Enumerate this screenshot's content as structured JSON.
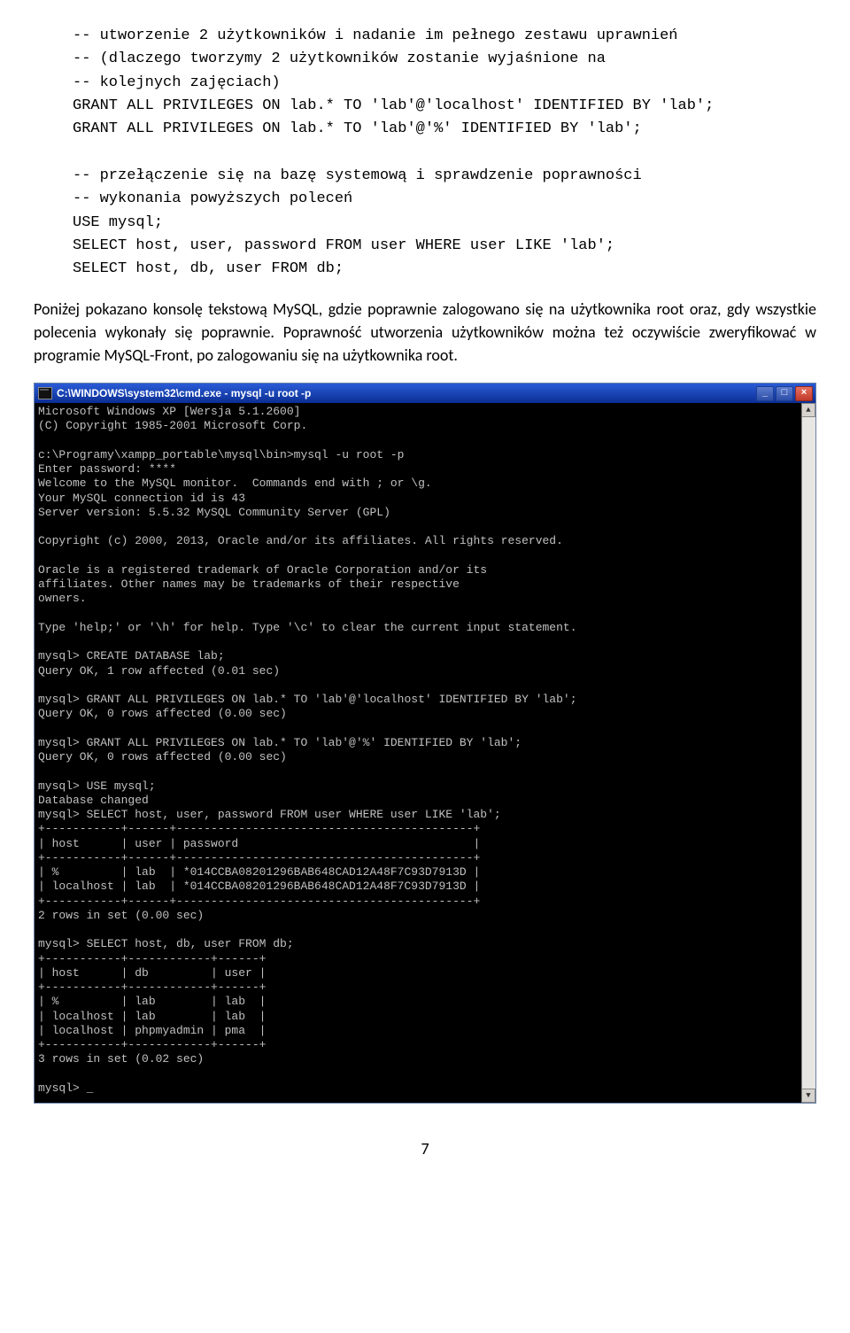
{
  "sql_block": "-- utworzenie 2 użytkowników i nadanie im pełnego zestawu uprawnień\n-- (dlaczego tworzymy 2 użytkowników zostanie wyjaśnione na\n-- kolejnych zajęciach)\nGRANT ALL PRIVILEGES ON lab.* TO 'lab'@'localhost' IDENTIFIED BY 'lab';\nGRANT ALL PRIVILEGES ON lab.* TO 'lab'@'%' IDENTIFIED BY 'lab';\n\n-- przełączenie się na bazę systemową i sprawdzenie poprawności\n-- wykonania powyższych poleceń\nUSE mysql;\nSELECT host, user, password FROM user WHERE user LIKE 'lab';\nSELECT host, db, user FROM db;",
  "paragraph": "Poniżej pokazano konsolę tekstową MySQL, gdzie poprawnie zalogowano się na użytkownika root oraz, gdy wszystkie polecenia wykonały się poprawnie. Poprawność utworzenia użytkowników można też oczywiście zweryfikować w programie MySQL-Front, po zalogowaniu się na użytkownika root.",
  "cmd": {
    "title": "C:\\WINDOWS\\system32\\cmd.exe - mysql -u root -p",
    "btn_min": "_",
    "btn_max": "□",
    "btn_close": "×",
    "scroll_up": "▲",
    "scroll_down": "▼",
    "body": "Microsoft Windows XP [Wersja 5.1.2600]\n(C) Copyright 1985-2001 Microsoft Corp.\n\nc:\\Programy\\xampp_portable\\mysql\\bin>mysql -u root -p\nEnter password: ****\nWelcome to the MySQL monitor.  Commands end with ; or \\g.\nYour MySQL connection id is 43\nServer version: 5.5.32 MySQL Community Server (GPL)\n\nCopyright (c) 2000, 2013, Oracle and/or its affiliates. All rights reserved.\n\nOracle is a registered trademark of Oracle Corporation and/or its\naffiliates. Other names may be trademarks of their respective\nowners.\n\nType 'help;' or '\\h' for help. Type '\\c' to clear the current input statement.\n\nmysql> CREATE DATABASE lab;\nQuery OK, 1 row affected (0.01 sec)\n\nmysql> GRANT ALL PRIVILEGES ON lab.* TO 'lab'@'localhost' IDENTIFIED BY 'lab';\nQuery OK, 0 rows affected (0.00 sec)\n\nmysql> GRANT ALL PRIVILEGES ON lab.* TO 'lab'@'%' IDENTIFIED BY 'lab';\nQuery OK, 0 rows affected (0.00 sec)\n\nmysql> USE mysql;\nDatabase changed\nmysql> SELECT host, user, password FROM user WHERE user LIKE 'lab';\n+-----------+------+-------------------------------------------+\n| host      | user | password                                  |\n+-----------+------+-------------------------------------------+\n| %         | lab  | *014CCBA08201296BAB648CAD12A48F7C93D7913D |\n| localhost | lab  | *014CCBA08201296BAB648CAD12A48F7C93D7913D |\n+-----------+------+-------------------------------------------+\n2 rows in set (0.00 sec)\n\nmysql> SELECT host, db, user FROM db;\n+-----------+------------+------+\n| host      | db         | user |\n+-----------+------------+------+\n| %         | lab        | lab  |\n| localhost | lab        | lab  |\n| localhost | phpmyadmin | pma  |\n+-----------+------------+------+\n3 rows in set (0.02 sec)\n\nmysql> _"
  },
  "page_number": "7"
}
